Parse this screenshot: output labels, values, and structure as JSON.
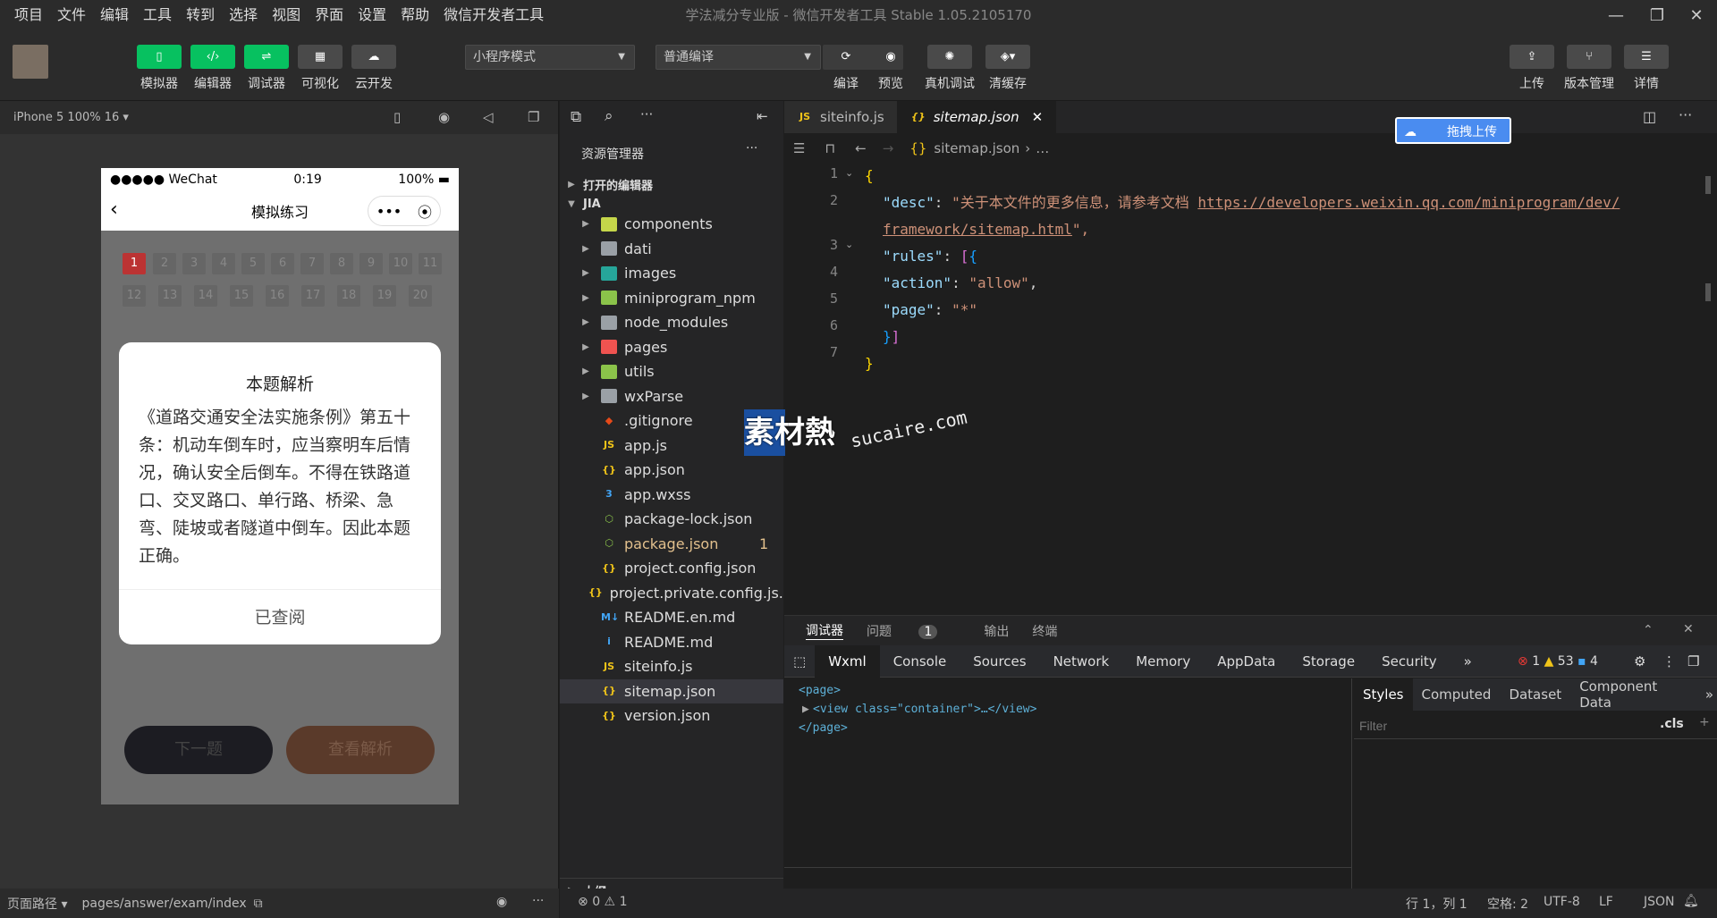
{
  "menubar": {
    "items": [
      "项目",
      "文件",
      "编辑",
      "工具",
      "转到",
      "选择",
      "视图",
      "界面",
      "设置",
      "帮助",
      "微信开发者工具"
    ],
    "title": "学法减分专业版 - 微信开发者工具 Stable 1.05.2105170"
  },
  "toolbar": {
    "simulator": "模拟器",
    "editor": "编辑器",
    "debugger": "调试器",
    "visual": "可视化",
    "cloud": "云开发",
    "mode_select": "小程序模式",
    "compile_select": "普通编译",
    "compile": "编译",
    "preview": "预览",
    "remote_debug": "真机调试",
    "clear_cache": "清缓存",
    "upload": "上传",
    "version": "版本管理",
    "details": "详情"
  },
  "simulator": {
    "device": "iPhone 5 100% 16 ▾",
    "status_carrier": "●●●●● WeChat",
    "status_time": "0:19",
    "status_battery": "100%",
    "nav_title": "模拟练习",
    "question_numbers": [
      "1",
      "2",
      "3",
      "4",
      "5",
      "6",
      "7",
      "8",
      "9",
      "10",
      "11",
      "12",
      "13",
      "14",
      "15",
      "16",
      "17",
      "18",
      "19",
      "20"
    ],
    "modal_title": "本题解析",
    "modal_body": "《道路交通安全法实施条例》第五十条：机动车倒车时，应当察明车后情况，确认安全后倒车。不得在铁路道口、交叉路口、单行路、桥梁、急弯、陡坡或者隧道中倒车。因此本题正确。",
    "modal_button": "已查阅",
    "next_button": "下一题",
    "analysis_button": "查看解析",
    "footer_path_label": "页面路径 ▾",
    "footer_path": "pages/answer/exam/index"
  },
  "explorer": {
    "title": "资源管理器",
    "open_editors": "打开的编辑器",
    "root": "JIA",
    "outline": "大纲",
    "items": [
      {
        "name": "components",
        "type": "folder",
        "color": "#c5d64a"
      },
      {
        "name": "dati",
        "type": "folder",
        "color": "#9aa0a6"
      },
      {
        "name": "images",
        "type": "folder",
        "color": "#26a69a"
      },
      {
        "name": "miniprogram_npm",
        "type": "folder",
        "color": "#8bc34a"
      },
      {
        "name": "node_modules",
        "type": "folder",
        "color": "#9aa0a6"
      },
      {
        "name": "pages",
        "type": "folder",
        "color": "#ef5350"
      },
      {
        "name": "utils",
        "type": "folder",
        "color": "#8bc34a"
      },
      {
        "name": "wxParse",
        "type": "folder",
        "color": "#9aa0a6"
      },
      {
        "name": ".gitignore",
        "type": "git",
        "color": "#e64a19"
      },
      {
        "name": "app.js",
        "type": "js",
        "color": "#f0c419"
      },
      {
        "name": "app.json",
        "type": "json",
        "color": "#f0c419"
      },
      {
        "name": "app.wxss",
        "type": "css",
        "color": "#42a5f5"
      },
      {
        "name": "package-lock.json",
        "type": "npm",
        "color": "#8bc34a"
      },
      {
        "name": "package.json",
        "type": "npm",
        "color": "#8bc34a",
        "badge": "1"
      },
      {
        "name": "project.config.json",
        "type": "json",
        "color": "#f0c419"
      },
      {
        "name": "project.private.config.js...",
        "type": "json",
        "color": "#f0c419"
      },
      {
        "name": "README.en.md",
        "type": "md",
        "color": "#42a5f5"
      },
      {
        "name": "README.md",
        "type": "info",
        "color": "#42a5f5"
      },
      {
        "name": "siteinfo.js",
        "type": "js",
        "color": "#f0c419"
      },
      {
        "name": "sitemap.json",
        "type": "json",
        "color": "#f0c419",
        "selected": true
      },
      {
        "name": "version.json",
        "type": "json",
        "color": "#f0c419"
      }
    ]
  },
  "editor": {
    "tab1": "siteinfo.js",
    "tab2": "sitemap.json",
    "breadcrumb_file": "sitemap.json",
    "breadcrumb_more": "…",
    "upload_badge": "拖拽上传",
    "lines": [
      "1",
      "2",
      "",
      "3",
      "4",
      "5",
      "6",
      "7"
    ],
    "code": {
      "desc_key": "\"desc\"",
      "desc_val": "\"关于本文件的更多信息，请参考文档 ",
      "url1": "https://developers.weixin.qq.com/miniprogram/dev/",
      "url2": "framework/sitemap.html",
      "desc_end": "\",",
      "rules_key": "\"rules\"",
      "action_key": "\"action\"",
      "action_val": "\"allow\"",
      "page_key": "\"page\"",
      "page_val": "\"*\""
    }
  },
  "watermark": {
    "cn": "素材熱",
    "en": "sucaire.com"
  },
  "debugger": {
    "tabs": [
      "调试器",
      "问题",
      "输出",
      "终端"
    ],
    "problem_count": "1",
    "devtools": [
      "Wxml",
      "Console",
      "Sources",
      "Network",
      "Memory",
      "AppData",
      "Storage",
      "Security"
    ],
    "errors": "1",
    "warnings": "53",
    "infos": "4",
    "xml": [
      "<page>",
      "<view class=\"container\">…</view>",
      "</page>"
    ],
    "style_tabs": [
      "Styles",
      "Computed",
      "Dataset",
      "Component Data"
    ],
    "filter_placeholder": "Filter",
    "cls": ".cls"
  },
  "statusbar": {
    "errors": "0",
    "warnings": "1",
    "position": "行 1，列 1",
    "spaces": "空格: 2",
    "encoding": "UTF-8",
    "eol": "LF",
    "lang": "JSON"
  }
}
